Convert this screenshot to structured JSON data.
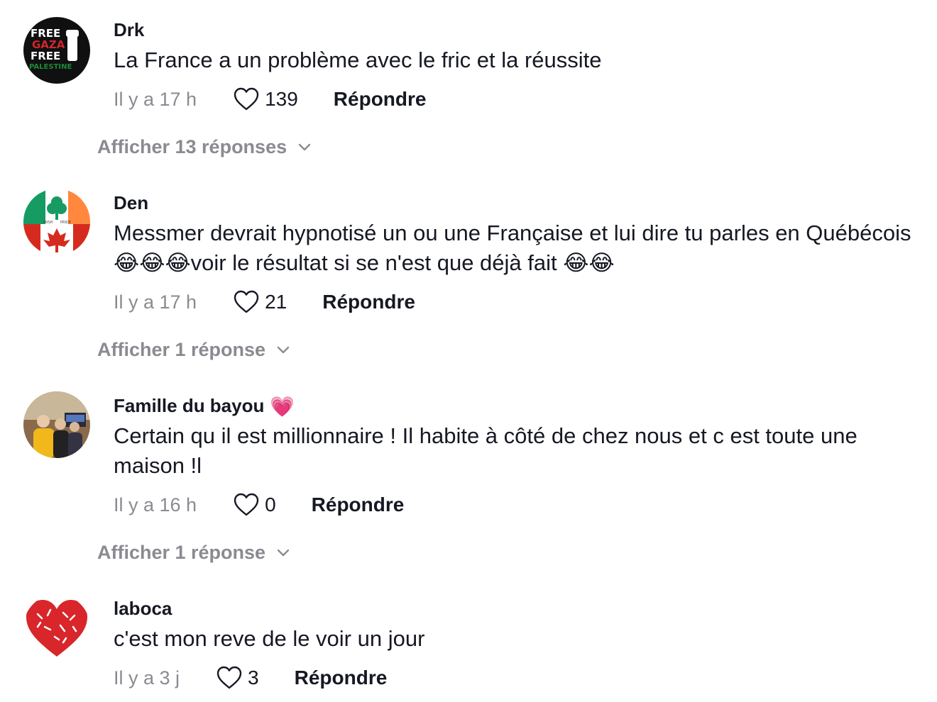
{
  "comments": [
    {
      "username": "Drk",
      "text": "La France a un problème avec le fric et la réussite",
      "time": "Il y a 17 h",
      "likes": "139",
      "reply_label": "Répondre",
      "replies_label": "Afficher 13 réponses",
      "avatar_text": [
        "FREE",
        "GAZA",
        "FREE",
        "PALESTINE"
      ]
    },
    {
      "username": "Den",
      "text": "Messmer devrait hypnotisé un ou une Française et lui dire tu parles en Québécois 😂😂😂voir le résultat si se n'est que déjà fait 😂😂",
      "time": "Il y a 17 h",
      "likes": "21",
      "reply_label": "Répondre",
      "replies_label": "Afficher 1 réponse",
      "avatar_text": [
        "IRISH",
        "PRIDE"
      ]
    },
    {
      "username": "Famille du bayou",
      "username_emoji": "💗",
      "text": "Certain qu il est millionnaire ! Il habite à côté de chez nous et c est toute une maison !l",
      "time": "Il y a 16 h",
      "likes": "0",
      "reply_label": "Répondre",
      "replies_label": "Afficher 1 réponse"
    },
    {
      "username": "laboca",
      "text": "c'est mon reve de le voir un jour",
      "time": "Il y a 3 j",
      "likes": "3",
      "reply_label": "Répondre"
    }
  ],
  "colors": {
    "primary_text": "#161823",
    "secondary_text": "#8a8b91",
    "background": "#ffffff"
  },
  "icons": {
    "like": "heart-outline-icon",
    "expand": "chevron-down-icon"
  }
}
